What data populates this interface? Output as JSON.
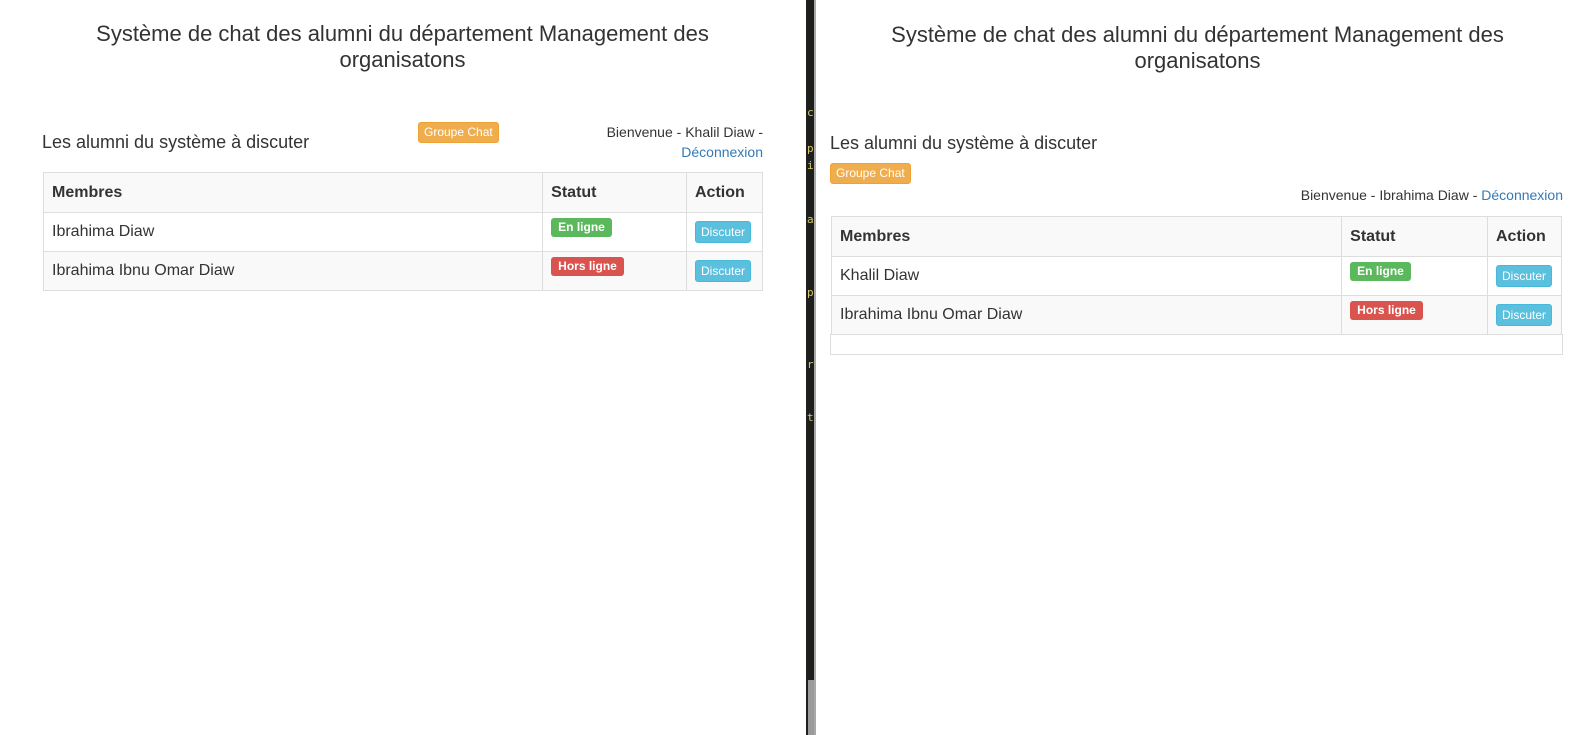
{
  "left": {
    "title": "Système de chat des alumni du département Management des organisatons",
    "subheading": "Les alumni du système à discuter",
    "group_chat_label": "Groupe Chat",
    "welcome_text": "Bienvenue - Khalil Diaw -",
    "logout_label": "Déconnexion",
    "table": {
      "headers": [
        "Membres",
        "Statut",
        "Action"
      ],
      "rows": [
        {
          "name": "Ibrahima Diaw",
          "status": "En ligne",
          "action": "Discuter"
        },
        {
          "name": "Ibrahima Ibnu Omar Diaw",
          "status": "Hors ligne",
          "action": "Discuter"
        }
      ]
    }
  },
  "right": {
    "title": "Système de chat des alumni du département Management des organisatons",
    "subheading": "Les alumni du système à discuter",
    "group_chat_label": "Groupe Chat",
    "welcome_text": "Bienvenue - Ibrahima Diaw -",
    "logout_label": "Déconnexion",
    "table": {
      "headers": [
        "Membres",
        "Statut",
        "Action"
      ],
      "rows": [
        {
          "name": "Khalil Diaw",
          "status": "En ligne",
          "action": "Discuter"
        },
        {
          "name": "Ibrahima Ibnu Omar Diaw",
          "status": "Hors ligne",
          "action": "Discuter"
        }
      ]
    }
  },
  "divider_glyphs": [
    "c",
    "p",
    "i",
    "a",
    "p",
    "r",
    "t"
  ],
  "colors": {
    "online": "#5cb85c",
    "offline": "#d9534f",
    "group_chat": "#f0ad4e",
    "discuss": "#5bc0de",
    "link": "#337ab7"
  }
}
